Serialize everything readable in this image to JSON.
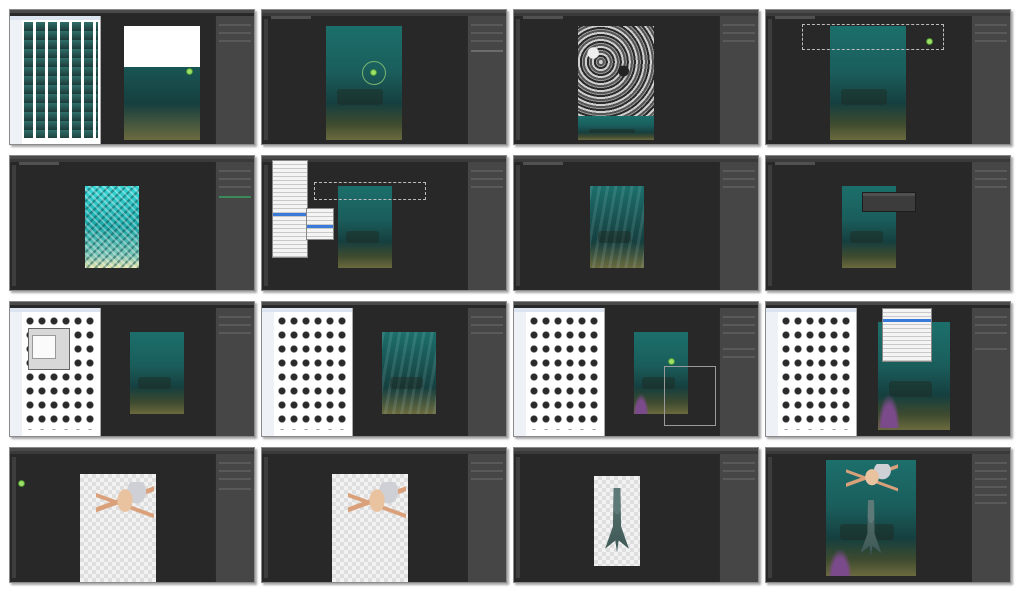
{
  "sheet": {
    "rows": 4,
    "columns": 4,
    "thumbnails": [
      {
        "scene": "file-browser-with-sea-canvas"
      },
      {
        "scene": "sea-canvas-with-brush-cursor"
      },
      {
        "scene": "noise-texture-layer"
      },
      {
        "scene": "sea-canvas-marquee"
      },
      {
        "scene": "sparkle-texture-layer"
      },
      {
        "scene": "filter-menu-open"
      },
      {
        "scene": "sea-canvas-light-rays"
      },
      {
        "scene": "adjustment-dialog"
      },
      {
        "scene": "brush-browser-with-dialog"
      },
      {
        "scene": "brush-browser-sea-canvas"
      },
      {
        "scene": "brush-browser-with-transform"
      },
      {
        "scene": "brush-browser-with-menu"
      },
      {
        "scene": "mermaid-arms-on-transparent"
      },
      {
        "scene": "mermaid-arms-on-transparent-2"
      },
      {
        "scene": "mermaid-tail-on-transparent"
      },
      {
        "scene": "composited-mermaid-scene"
      }
    ]
  },
  "colors": {
    "app_background": "#282828",
    "panel": "#464646",
    "sea_top": "#1c6f6c",
    "sand": "#6b6a3e",
    "highlight": "#3a7ad9"
  }
}
